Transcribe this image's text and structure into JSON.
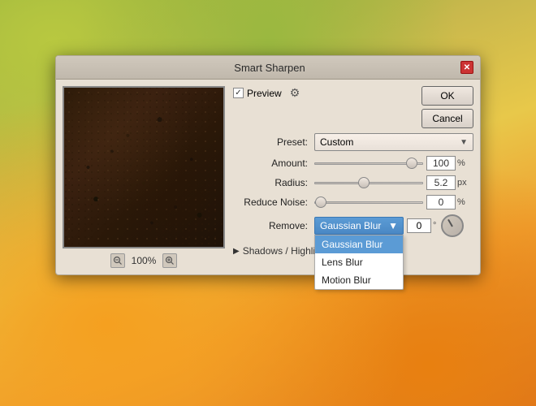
{
  "dialog": {
    "title": "Smart Sharpen",
    "close_label": "✕"
  },
  "preview": {
    "checkbox_checked": "✓",
    "label": "Preview",
    "zoom_out": "🔍",
    "zoom_in": "🔍",
    "zoom_level": "100%"
  },
  "buttons": {
    "ok": "OK",
    "cancel": "Cancel"
  },
  "preset": {
    "label": "Preset:",
    "value": "Custom"
  },
  "amount": {
    "label": "Amount:",
    "value": "100",
    "unit": "%",
    "thumb_pos": "85%"
  },
  "radius": {
    "label": "Radius:",
    "value": "5.2",
    "unit": "px",
    "thumb_pos": "50%"
  },
  "reduce_noise": {
    "label": "Reduce Noise:",
    "value": "0",
    "unit": "%",
    "thumb_pos": "0%"
  },
  "remove": {
    "label": "Remove:",
    "selected": "Gaussian Blur",
    "angle_value": "0",
    "options": [
      {
        "label": "Gaussian Blur",
        "active": true
      },
      {
        "label": "Lens Blur",
        "active": false
      },
      {
        "label": "Motion Blur",
        "active": false
      }
    ]
  },
  "shadows": {
    "label": "Shadows / Highlights"
  },
  "colors": {
    "accent_blue": "#5b9bd5",
    "dialog_bg": "#e8e0d4",
    "titlebar_bg": "#c8c0b4"
  }
}
